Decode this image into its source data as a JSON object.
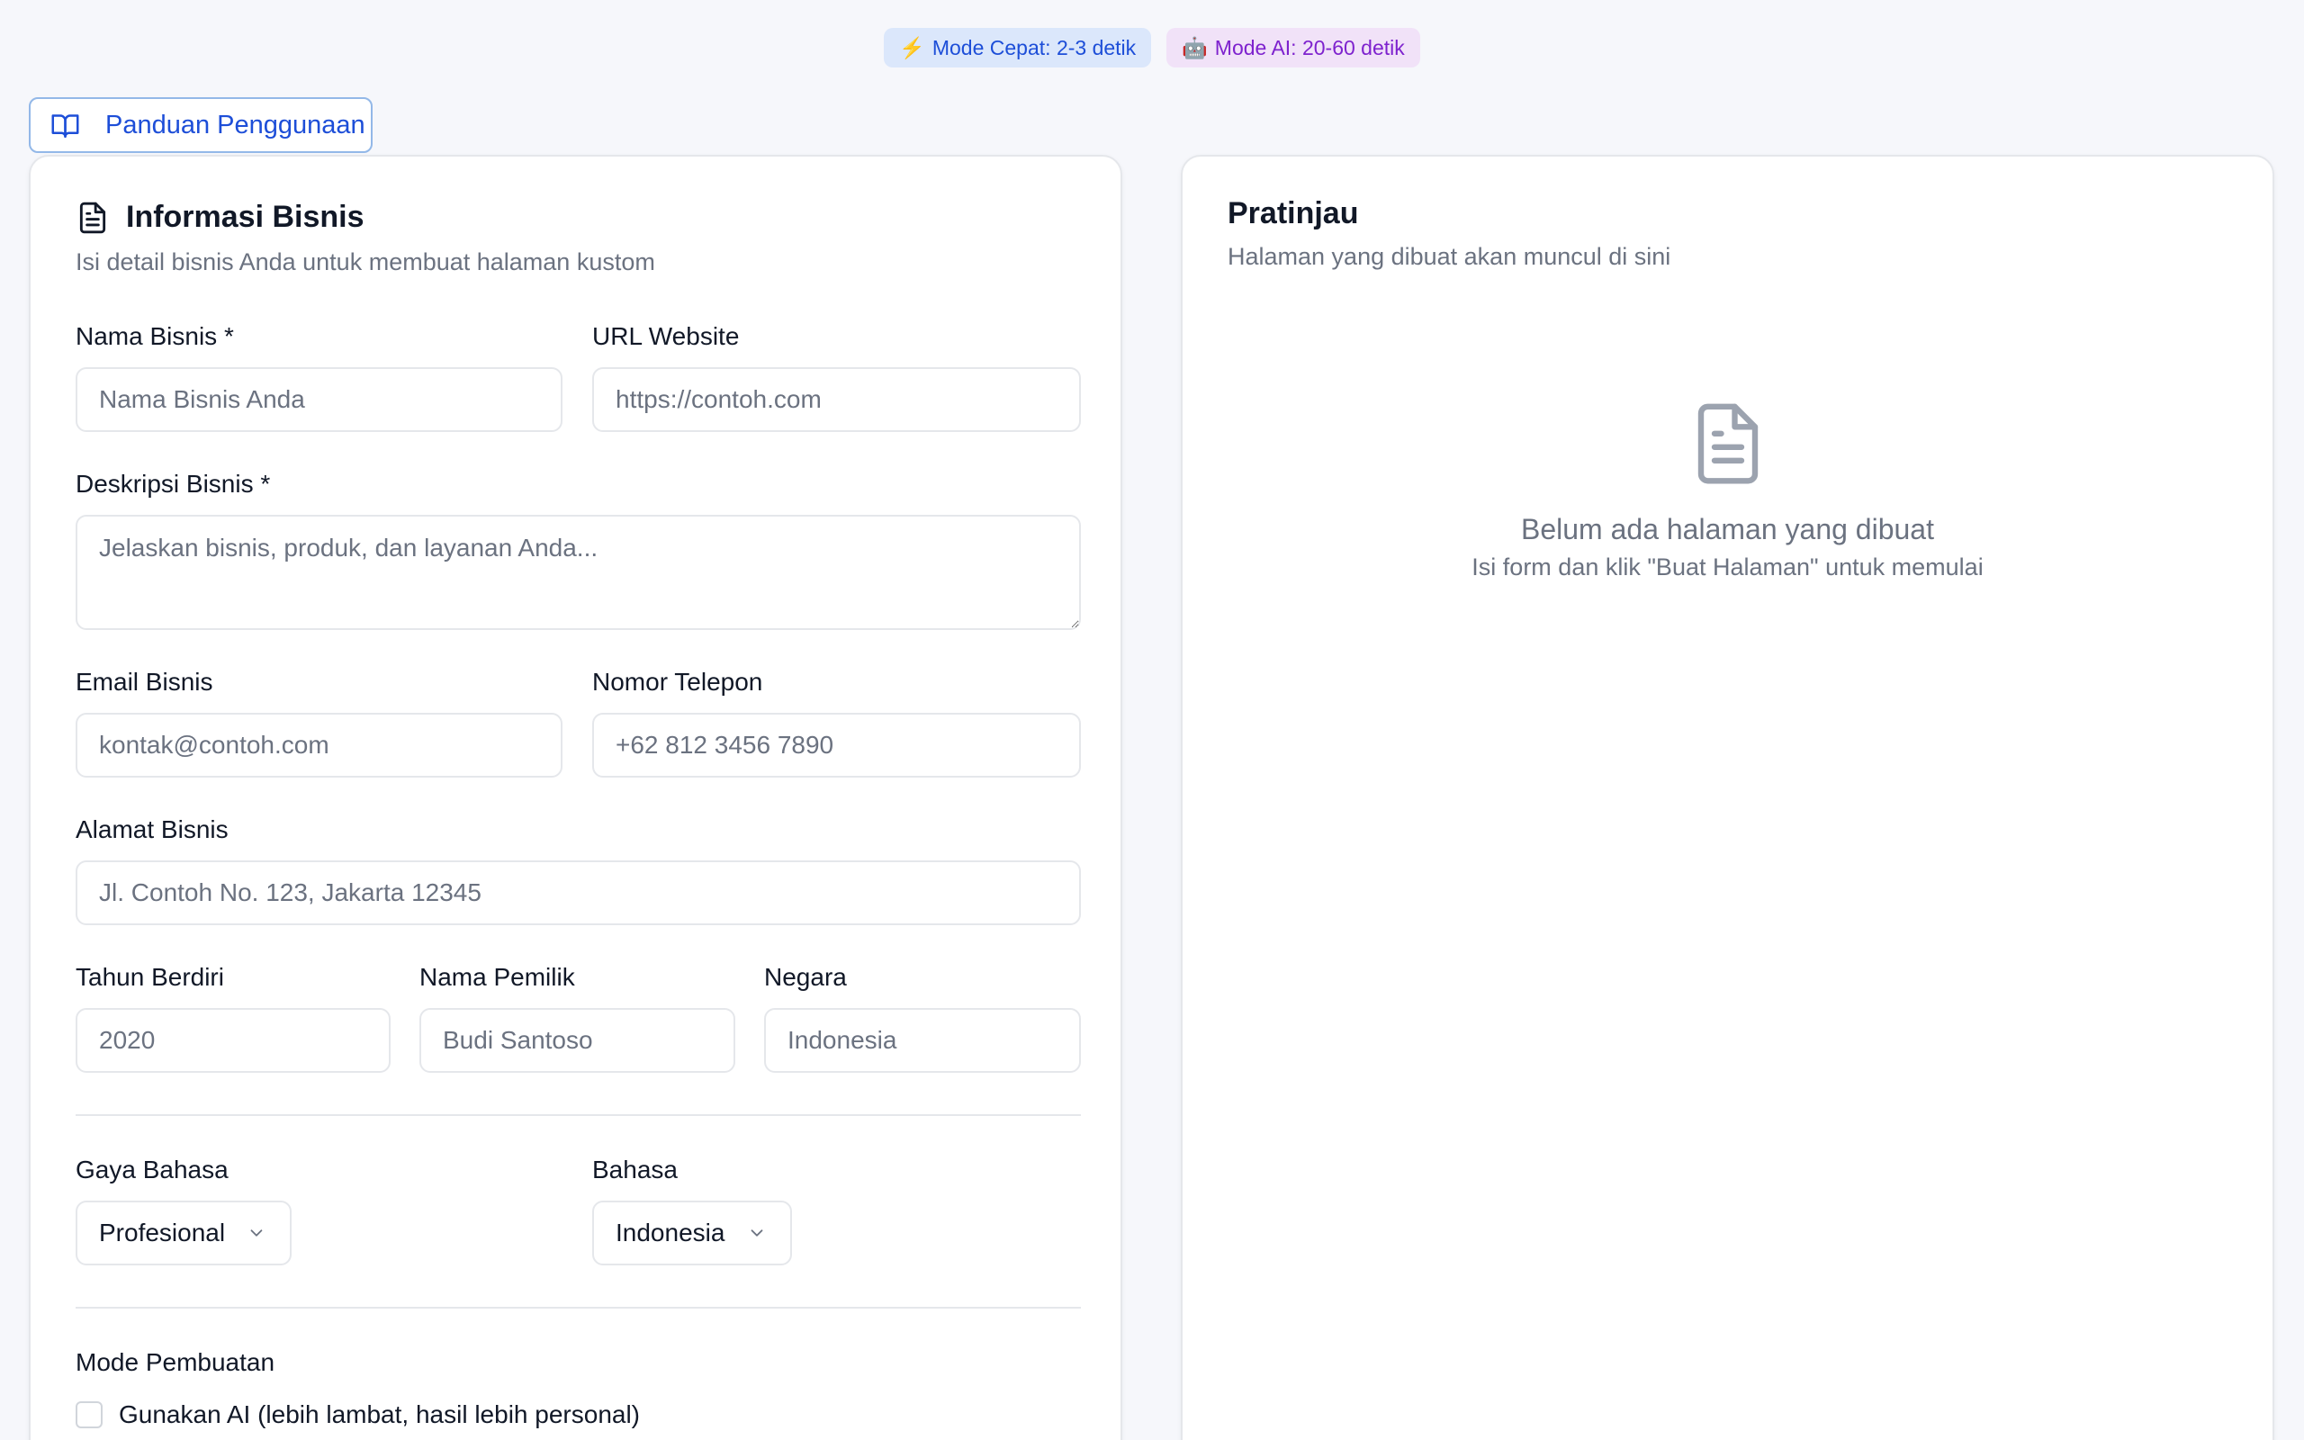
{
  "badges": {
    "fast": {
      "icon": "⚡",
      "label": "Mode Cepat: 2-3 detik"
    },
    "ai": {
      "icon": "🤖",
      "label": "Mode AI: 20-60 detik"
    }
  },
  "guide_button": {
    "label": "Panduan Penggunaan",
    "icon": "book-open-icon"
  },
  "form": {
    "title": "Informasi Bisnis",
    "subtitle": "Isi detail bisnis Anda untuk membuat halaman kustom",
    "business_name": {
      "label": "Nama Bisnis *",
      "placeholder": "Nama Bisnis Anda",
      "value": ""
    },
    "website": {
      "label": "URL Website",
      "placeholder": "https://contoh.com",
      "value": ""
    },
    "description": {
      "label": "Deskripsi Bisnis *",
      "placeholder": "Jelaskan bisnis, produk, dan layanan Anda...",
      "value": ""
    },
    "email": {
      "label": "Email Bisnis",
      "placeholder": "kontak@contoh.com",
      "value": ""
    },
    "phone": {
      "label": "Nomor Telepon",
      "placeholder": "+62 812 3456 7890",
      "value": ""
    },
    "address": {
      "label": "Alamat Bisnis",
      "placeholder": "Jl. Contoh No. 123, Jakarta 12345",
      "value": ""
    },
    "founded": {
      "label": "Tahun Berdiri",
      "placeholder": "2020",
      "value": ""
    },
    "owner": {
      "label": "Nama Pemilik",
      "placeholder": "Budi Santoso",
      "value": ""
    },
    "country": {
      "label": "Negara",
      "placeholder": "Indonesia",
      "value": ""
    },
    "tone": {
      "label": "Gaya Bahasa",
      "selected": "Profesional"
    },
    "language": {
      "label": "Bahasa",
      "selected": "Indonesia"
    },
    "mode": {
      "label": "Mode Pembuatan",
      "checkbox_label": "Gunakan AI (lebih lambat, hasil lebih personal)",
      "checked": false
    }
  },
  "preview": {
    "title": "Pratinjau",
    "subtitle": "Halaman yang dibuat akan muncul di sini",
    "empty_title": "Belum ada halaman yang dibuat",
    "empty_subtitle": "Isi form dan klik \"Buat Halaman\" untuk memulai"
  },
  "colors": {
    "accent": "#1d4ed8",
    "ai_accent": "#7e22ce",
    "muted_text": "#6b7280",
    "border": "#e5e7eb"
  }
}
